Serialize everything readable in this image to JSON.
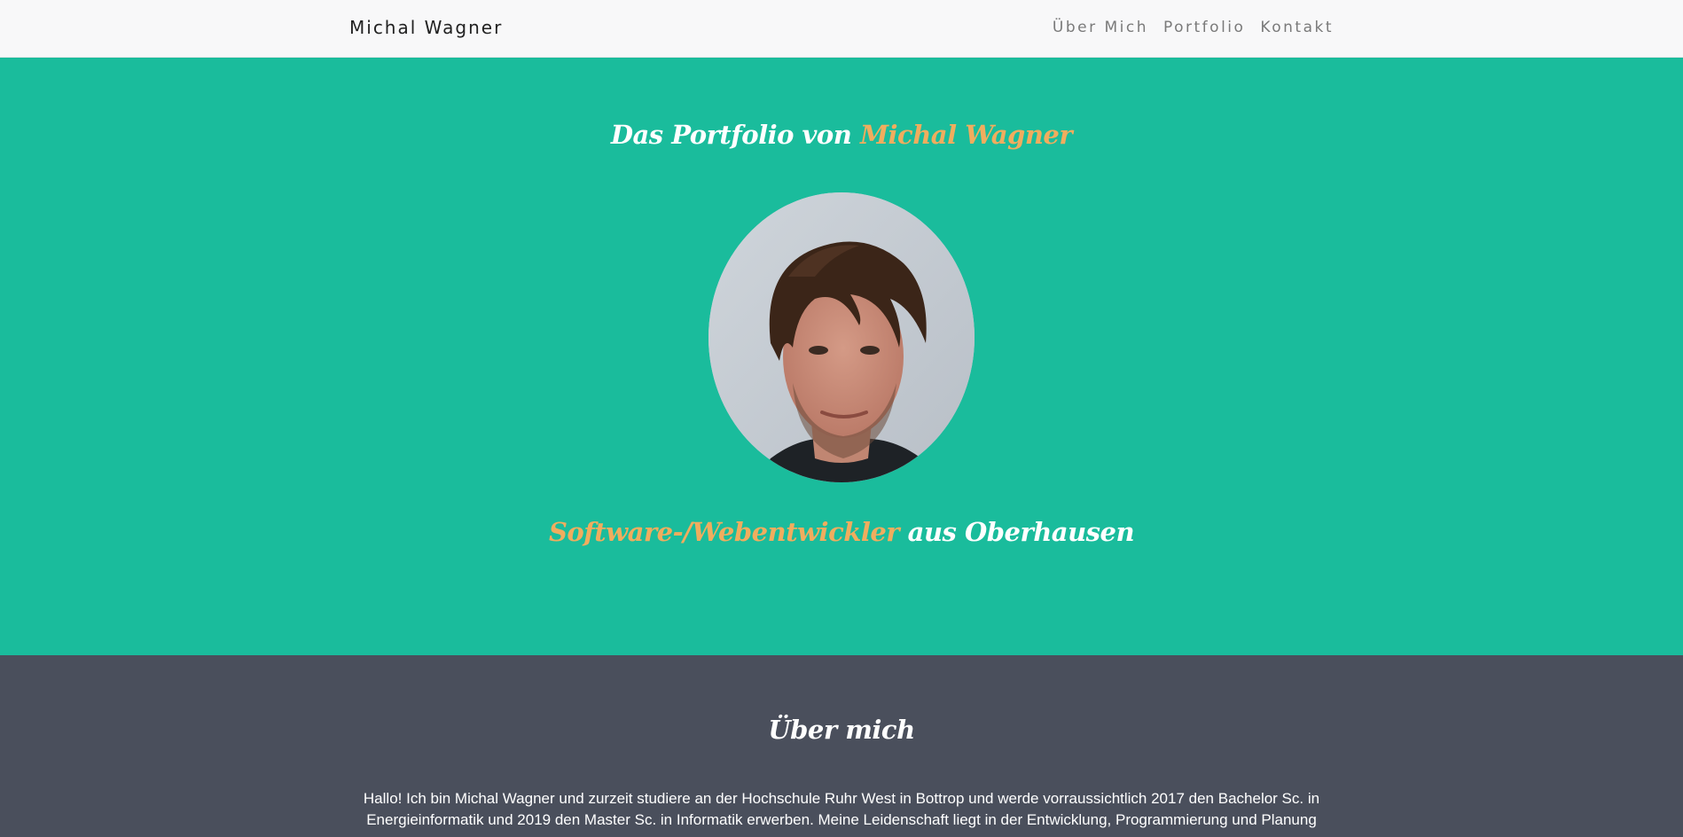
{
  "navbar": {
    "brand": "Michal Wagner",
    "links": [
      {
        "label": "Über Mich"
      },
      {
        "label": "Portfolio"
      },
      {
        "label": "Kontakt"
      }
    ]
  },
  "hero": {
    "title_prefix": "Das Portfolio von ",
    "title_highlight": "Michal Wagner",
    "subtitle_highlight": "Software-/Webentwickler",
    "subtitle_suffix": " aus Oberhausen"
  },
  "about": {
    "title": "Über mich",
    "text": "Hallo! Ich bin Michal Wagner und zurzeit studiere an der Hochschule Ruhr West in Bottrop und werde vorraussichtlich 2017 den Bachelor Sc. in Energieinformatik und 2019 den Master Sc. in Informatik erwerben. Meine Leidenschaft liegt in der Entwicklung, Programmierung und Planung"
  },
  "colors": {
    "hero_bg": "#1abc9c",
    "accent": "#f0ad5e",
    "about_bg": "#4a4f5c",
    "navbar_bg": "#f8f8f9"
  }
}
